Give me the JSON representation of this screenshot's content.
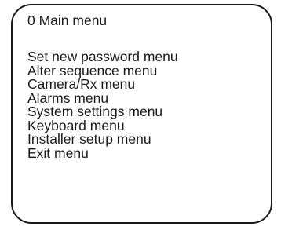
{
  "menu": {
    "title": "0 Main menu",
    "items": [
      "Set new password menu",
      "Alter sequence menu",
      "Camera/Rx menu",
      "Alarms menu",
      "System settings menu",
      "Keyboard menu",
      "Installer setup menu",
      "Exit menu"
    ]
  }
}
